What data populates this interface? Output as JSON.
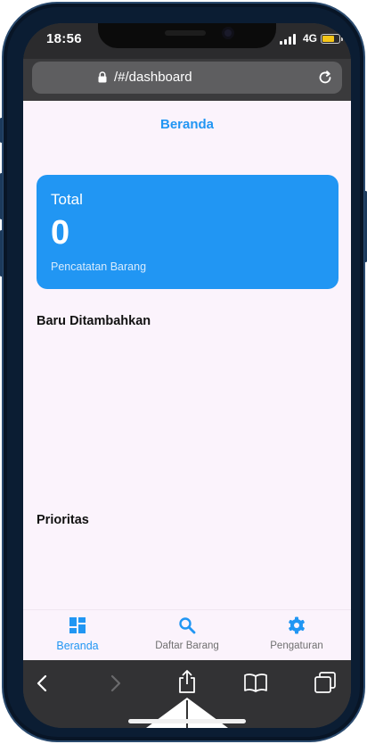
{
  "status_bar": {
    "time": "18:56",
    "network": "4G"
  },
  "browser": {
    "url": "/#/dashboard"
  },
  "page": {
    "title": "Beranda",
    "summary_card": {
      "label": "Total",
      "value": "0",
      "caption": "Pencatatan Barang",
      "color": "#2196f3"
    },
    "sections": {
      "recent_title": "Baru Ditambahkan",
      "priority_title": "Prioritas"
    }
  },
  "bottom_nav": {
    "items": [
      {
        "label": "Beranda",
        "icon": "dashboard-icon",
        "active": true
      },
      {
        "label": "Daftar Barang",
        "icon": "search-icon",
        "active": false
      },
      {
        "label": "Pengaturan",
        "icon": "gear-icon",
        "active": false
      }
    ],
    "active_color": "#2196f3"
  },
  "toolbar": {
    "icons": [
      "back-icon",
      "forward-icon",
      "share-icon",
      "bookmarks-icon",
      "tabs-icon"
    ]
  }
}
